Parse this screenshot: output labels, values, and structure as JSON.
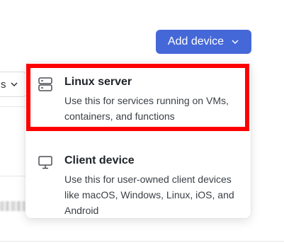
{
  "background": {
    "filter_label_fragment": "s"
  },
  "header": {
    "add_device_label": "Add device"
  },
  "menu": {
    "items": [
      {
        "title": "Linux server",
        "description": "Use this for services running on VMs, containers, and functions",
        "icon": "server-icon"
      },
      {
        "title": "Client device",
        "description": "Use this for user-owned client devices like macOS, Windows, Linux, iOS, and Android",
        "icon": "monitor-icon"
      }
    ]
  },
  "colors": {
    "accent": "#4568d8",
    "highlight": "#ff0000"
  }
}
